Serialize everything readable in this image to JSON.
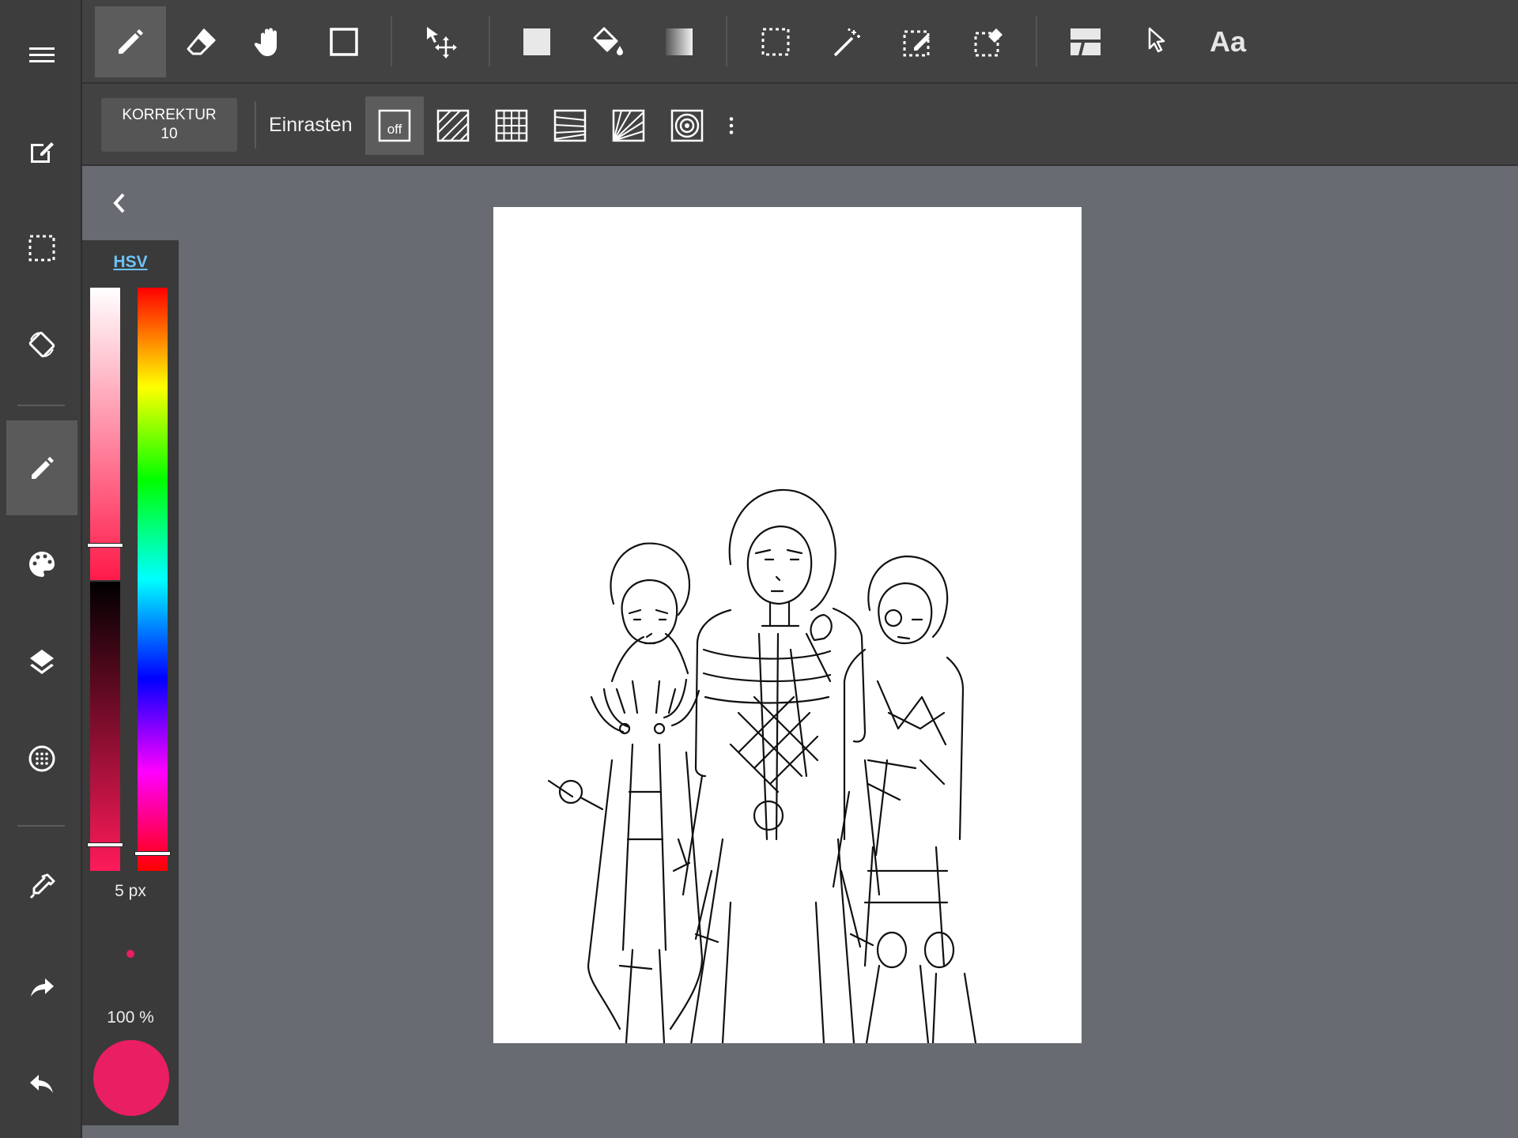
{
  "sidebar": {
    "items": [
      {
        "icon": "menu-icon"
      },
      {
        "icon": "edit-document-icon"
      },
      {
        "icon": "selection-icon"
      },
      {
        "icon": "rotate-screen-icon"
      },
      {
        "icon": "pen-icon",
        "active": true
      },
      {
        "icon": "palette-icon"
      },
      {
        "icon": "layers-icon"
      },
      {
        "icon": "material-icon"
      },
      {
        "icon": "eyedropper-icon"
      },
      {
        "icon": "redo-icon"
      },
      {
        "icon": "undo-icon"
      }
    ]
  },
  "toolbar": {
    "tools": [
      "pen-icon",
      "eraser-icon",
      "hand-icon",
      "shape-icon",
      "move-icon",
      "fill-rect-icon",
      "bucket-icon",
      "gradient-icon",
      "select-rect-icon",
      "magic-wand-icon",
      "select-pen-icon",
      "select-eraser-icon",
      "frame-divider-icon",
      "pointer-icon",
      "text-icon"
    ],
    "text_tool_label": "Aa"
  },
  "subbar": {
    "correction_label": "KORREKTUR",
    "correction_value": "10",
    "snap_label": "Einrasten",
    "snap_off_label": "off",
    "snap_modes": [
      "snap-off-icon",
      "snap-parallel-icon",
      "snap-grid-icon",
      "snap-perspective-icon",
      "snap-radial-icon",
      "snap-circle-icon"
    ]
  },
  "color_panel": {
    "mode_label": "HSV",
    "brush_size": "5 px",
    "opacity": "100 %",
    "current_color": "#e91e63",
    "hue_color": "#ff0000",
    "saturation_fraction": 0.88,
    "value_fraction": 0.91,
    "hue_fraction": 0.0
  },
  "colors": {
    "background": "#686b71",
    "sidebar": "#3d3d3d",
    "toolbar": "#424242",
    "accent": "#6fc3f7"
  }
}
